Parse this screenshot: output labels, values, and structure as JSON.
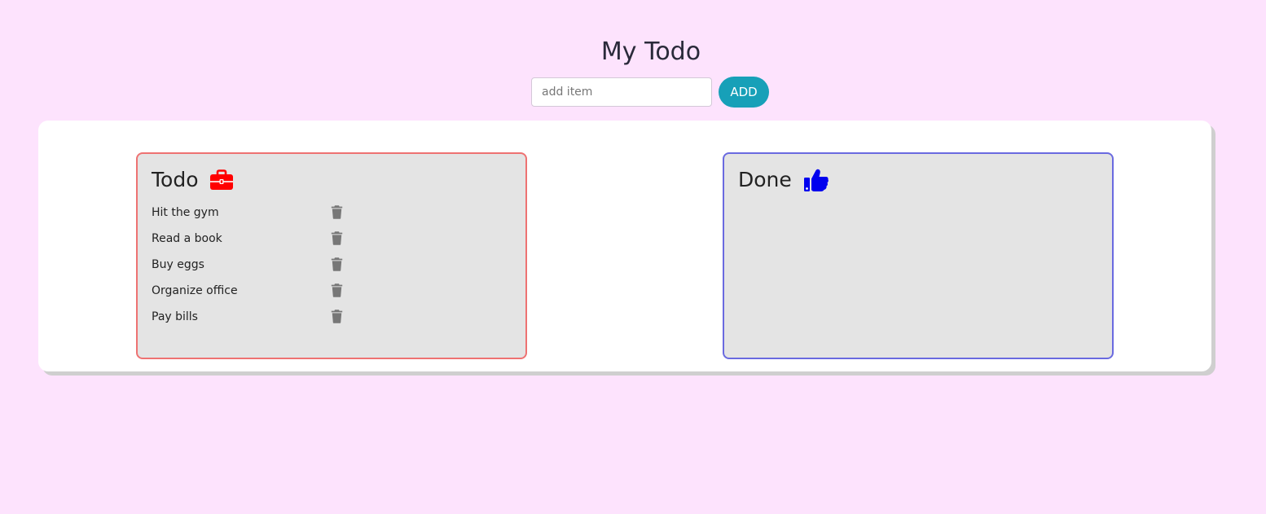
{
  "app": {
    "title": "My Todo"
  },
  "add_form": {
    "placeholder": "add item",
    "value": "",
    "button_label": "ADD"
  },
  "todo_panel": {
    "title": "Todo",
    "icon": "briefcase-icon",
    "accent_color": "#ee7272",
    "icon_color": "#ff0000",
    "items": [
      {
        "label": "Hit the gym"
      },
      {
        "label": "Read a book"
      },
      {
        "label": "Buy eggs"
      },
      {
        "label": "Organize office"
      },
      {
        "label": "Pay bills"
      }
    ],
    "item_action_icon": "trash-icon"
  },
  "done_panel": {
    "title": "Done",
    "icon": "thumbs-up-icon",
    "accent_color": "#6a6ae0",
    "icon_color": "#0000ee",
    "items": []
  },
  "colors": {
    "page_background": "#fde3fd",
    "button": "#17a0b8",
    "panel_background": "#e4e4e4",
    "trash": "#777777"
  }
}
